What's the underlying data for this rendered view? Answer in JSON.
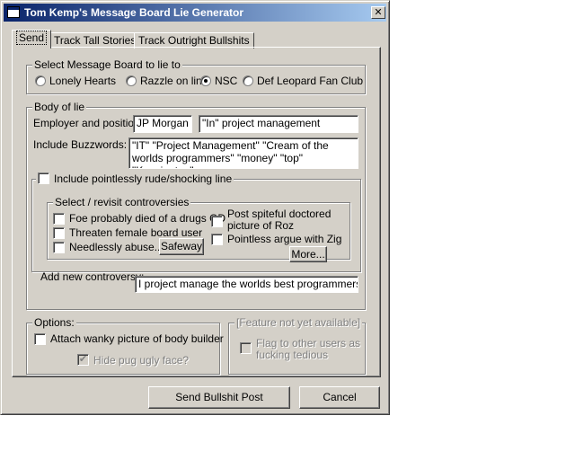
{
  "window": {
    "title": "Tom Kemp's Message Board Lie Generator",
    "close_glyph": "✕"
  },
  "tabs": [
    {
      "label": "Send",
      "active": true
    },
    {
      "label": "Track Tall Stories",
      "active": false
    },
    {
      "label": "Track Outright Bullshits",
      "active": false
    }
  ],
  "board_group": {
    "legend": "Select Message Board to lie to",
    "options": [
      {
        "label": "Lonely Hearts",
        "selected": false
      },
      {
        "label": "Razzle on line",
        "selected": false
      },
      {
        "label": "NSC",
        "selected": true
      },
      {
        "label": "Def Leopard Fan Club",
        "selected": false
      }
    ]
  },
  "body_group": {
    "legend": "Body of lie",
    "employer_label": "Employer and position",
    "employer_value": "JP Morgan",
    "position_value": "\"In\" project management",
    "buzzwords_label": "Include Buzzwords:",
    "buzzwords_value": "\"IT\" \"Project Management\" \"Cream of the worlds programmers\" \"money\" \"top\" \"Kensington\""
  },
  "rude_line": {
    "label": "Include pointlessly rude/shocking line",
    "checked": false
  },
  "controversies": {
    "legend": "Select / revisit controversies",
    "left_items": [
      {
        "label": "Foe probably died of a drugs OD",
        "checked": false
      },
      {
        "label": "Threaten female board user",
        "checked": false
      },
      {
        "label": "Needlessly abuse...",
        "checked": false
      }
    ],
    "safeway_button": "Safeway",
    "right_items": [
      {
        "label": "Post spiteful doctored picture of Roz",
        "checked": false
      },
      {
        "label": "Pointless argue with Zig",
        "checked": false
      }
    ],
    "more_button": "More...",
    "add_label": "Add new controversy:",
    "add_value": "I project manage the worlds best programmers"
  },
  "options_group": {
    "legend": "Options:",
    "attach_label": "Attach wanky picture of body builder",
    "attach_checked": false,
    "hide_label": "Hide pug ugly face?",
    "hide_checked": true
  },
  "feature_group": {
    "legend": "[Feature not yet available]",
    "flag_label": "Flag to other users as fucking tedious",
    "flag_checked": false
  },
  "footer": {
    "send_button": "Send Bullshit Post",
    "cancel_button": "Cancel"
  },
  "icons": {
    "check_glyph": "✔"
  }
}
